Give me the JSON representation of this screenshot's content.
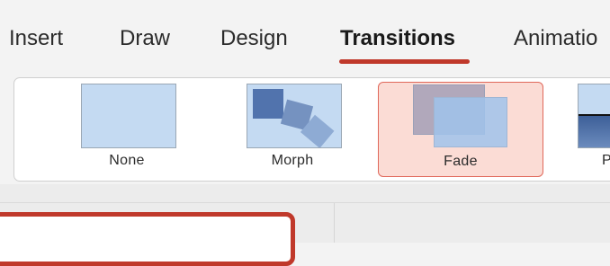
{
  "ribbon": {
    "tabs": [
      {
        "label": "Insert"
      },
      {
        "label": "Draw"
      },
      {
        "label": "Design"
      },
      {
        "label": "Transitions",
        "active": true
      },
      {
        "label": "Animatio"
      }
    ]
  },
  "transitions": {
    "items": [
      {
        "label": "None"
      },
      {
        "label": "Morph"
      },
      {
        "label": "Fade",
        "selected": true
      },
      {
        "label": "P"
      }
    ]
  },
  "colors": {
    "accent": "#c0392b",
    "selected_bg": "#fbdcd5",
    "thumb_blue": "#c4daf2"
  }
}
